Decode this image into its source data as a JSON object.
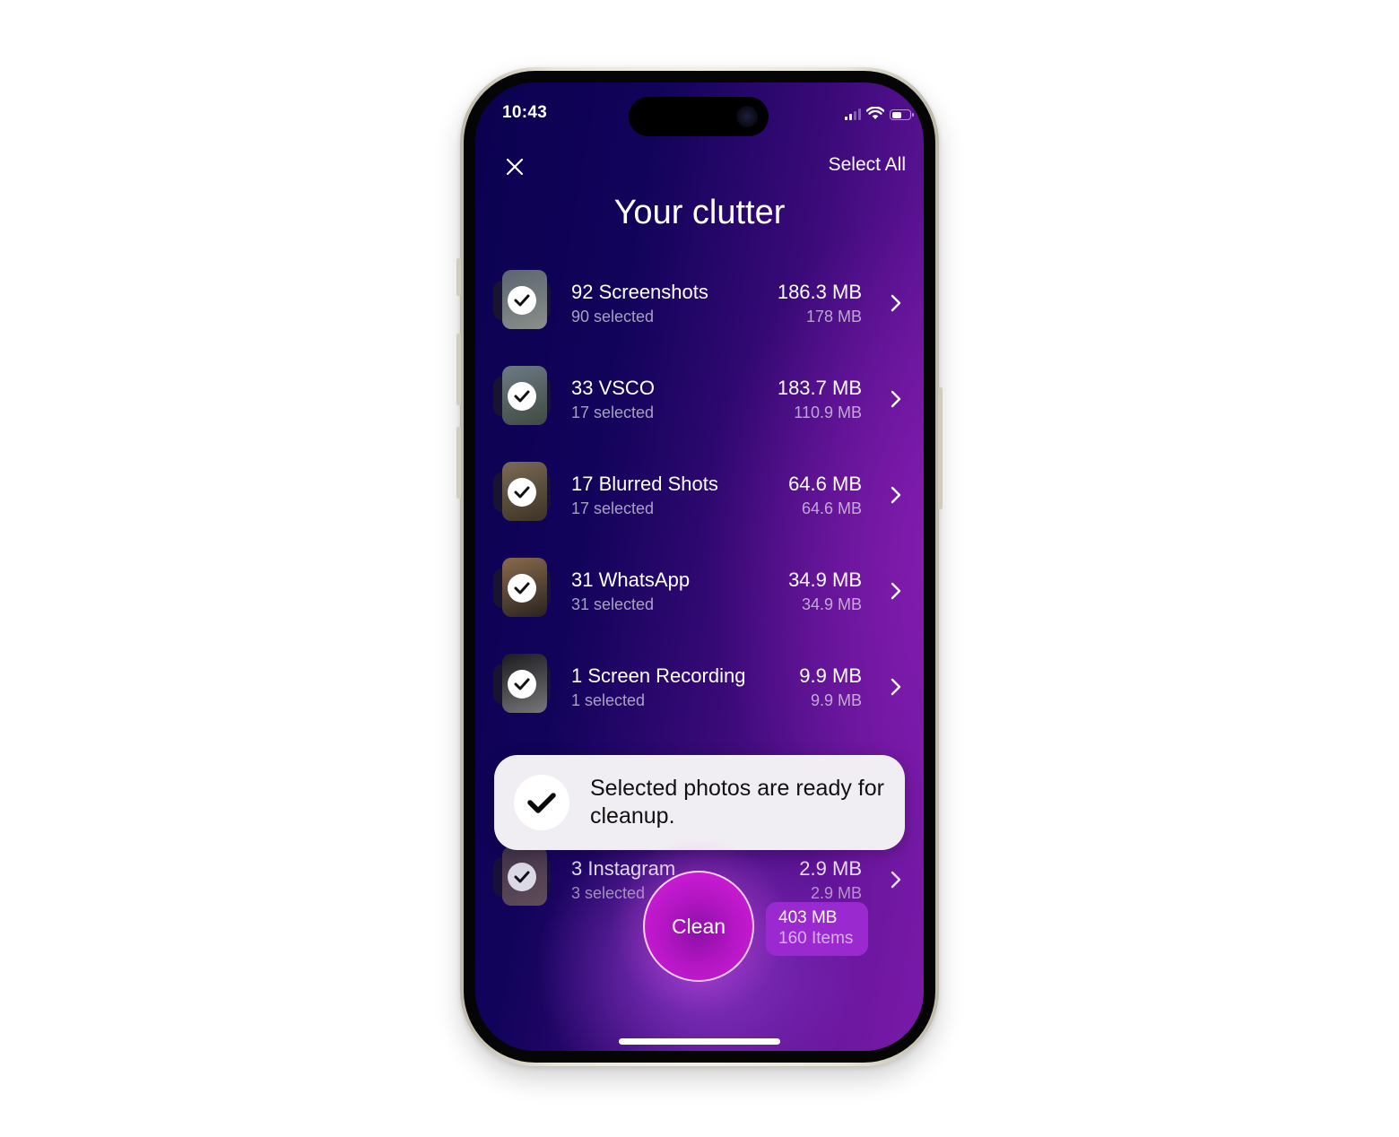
{
  "status_bar": {
    "time": "10:43",
    "signal_bars_active": 2,
    "signal_bars_total": 4,
    "battery_level": 0.55,
    "icons": [
      "cellular-signal-icon",
      "wifi-icon",
      "battery-icon"
    ]
  },
  "header": {
    "close_icon": "close-icon",
    "select_all_label": "Select All",
    "title": "Your clutter"
  },
  "categories": [
    {
      "title": "92 Screenshots",
      "subtitle": "90 selected",
      "size": "186.3 MB",
      "selected_size": "178 MB",
      "checked": true,
      "thumb_colors": [
        "#5b6470",
        "#8a8f8a"
      ]
    },
    {
      "title": "33 VSCO",
      "subtitle": "17 selected",
      "size": "183.7 MB",
      "selected_size": "110.9 MB",
      "checked": true,
      "thumb_colors": [
        "#6d7a85",
        "#3f4a40"
      ]
    },
    {
      "title": "17 Blurred Shots",
      "subtitle": "17 selected",
      "size": "64.6 MB",
      "selected_size": "64.6 MB",
      "checked": true,
      "thumb_colors": [
        "#7b6a55",
        "#3c3326"
      ]
    },
    {
      "title": "31 WhatsApp",
      "subtitle": "31 selected",
      "size": "34.9 MB",
      "selected_size": "34.9 MB",
      "checked": true,
      "thumb_colors": [
        "#8a6a4c",
        "#2a2320"
      ]
    },
    {
      "title": "1 Screen Recording",
      "subtitle": "1 selected",
      "size": "9.9 MB",
      "selected_size": "9.9 MB",
      "checked": true,
      "thumb_colors": [
        "#1b1b1e",
        "#77777a"
      ]
    },
    {
      "title": "3 Instagram",
      "subtitle": "3 selected",
      "size": "2.9 MB",
      "selected_size": "2.9 MB",
      "checked": true,
      "thumb_colors": [
        "#4a3a48",
        "#6e5b5a"
      ]
    }
  ],
  "toast": {
    "icon": "checkmark-icon",
    "message": "Selected photos are ready for cleanup."
  },
  "clean": {
    "button_label": "Clean",
    "total_size": "403 MB",
    "total_items": "160 Items"
  },
  "colors": {
    "background_dark": "#0b0150",
    "background_purple": "#7a1aa8",
    "clean_button": "#d81fe0",
    "summary_badge": "#9a2ad0",
    "toast_bg": "#f1eef3"
  }
}
